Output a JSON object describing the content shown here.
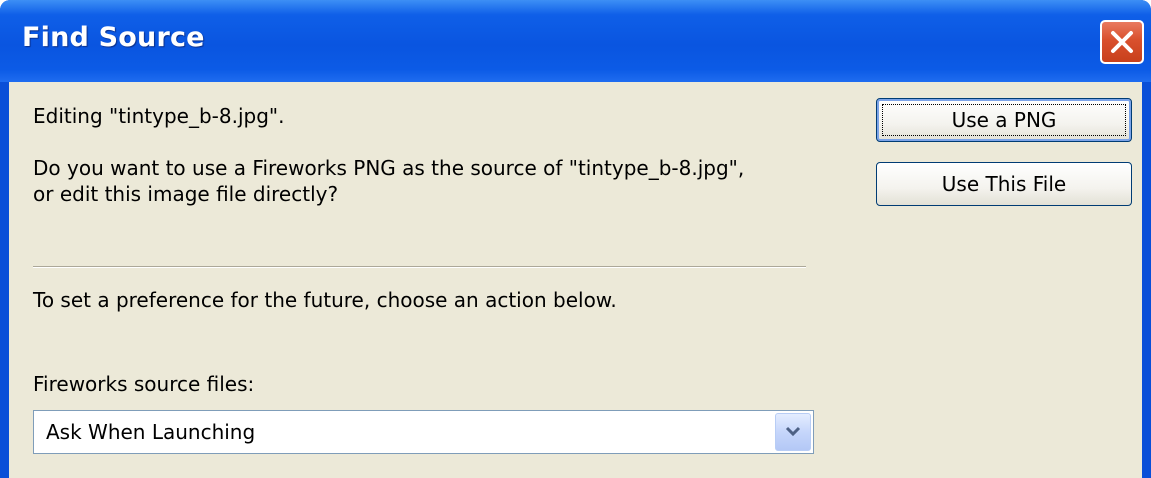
{
  "window": {
    "title": "Find Source"
  },
  "dialog": {
    "editing_text": "Editing \"tintype_b-8.jpg\".",
    "question_line1": "Do you want to use a Fireworks PNG as the source of \"tintype_b-8.jpg\",",
    "question_line2": "or edit this image file directly?",
    "preference_text": "To set a preference for the future, choose an action below.",
    "source_files_label": "Fireworks source files:",
    "source_files_select": {
      "selected": "Ask When Launching"
    }
  },
  "buttons": {
    "use_png_label": "Use a PNG",
    "use_this_file_label": "Use This File"
  },
  "icons": {
    "close": "close-icon",
    "dropdown": "chevron-down-icon"
  },
  "colors": {
    "titlebar": "#0a55e0",
    "body": "#ece9d8",
    "close_button": "#d9502d"
  }
}
